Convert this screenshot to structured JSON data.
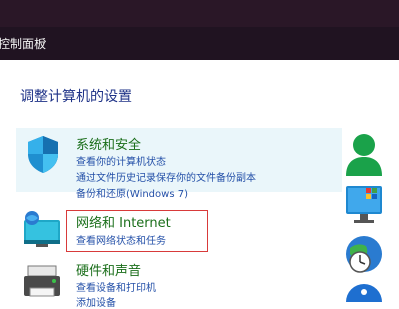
{
  "breadcrumb": {
    "label": "控制面板",
    "chevron": "›"
  },
  "page": {
    "title": "调整计算机的设置"
  },
  "categories": [
    {
      "title": "系统和安全",
      "icon": "shield-icon",
      "links": [
        "查看你的计算机状态",
        "通过文件历史记录保存你的文件备份副本",
        "备份和还原(Windows 7)"
      ]
    },
    {
      "title": "网络和 Internet",
      "icon": "network-icon",
      "links": [
        "查看网络状态和任务"
      ]
    },
    {
      "title": "硬件和声音",
      "icon": "printer-icon",
      "links": [
        "查看设备和打印机",
        "添加设备"
      ]
    }
  ],
  "right_icons": [
    "user-accounts-icon",
    "appearance-icon",
    "clock-region-icon",
    "ease-of-access-icon"
  ]
}
